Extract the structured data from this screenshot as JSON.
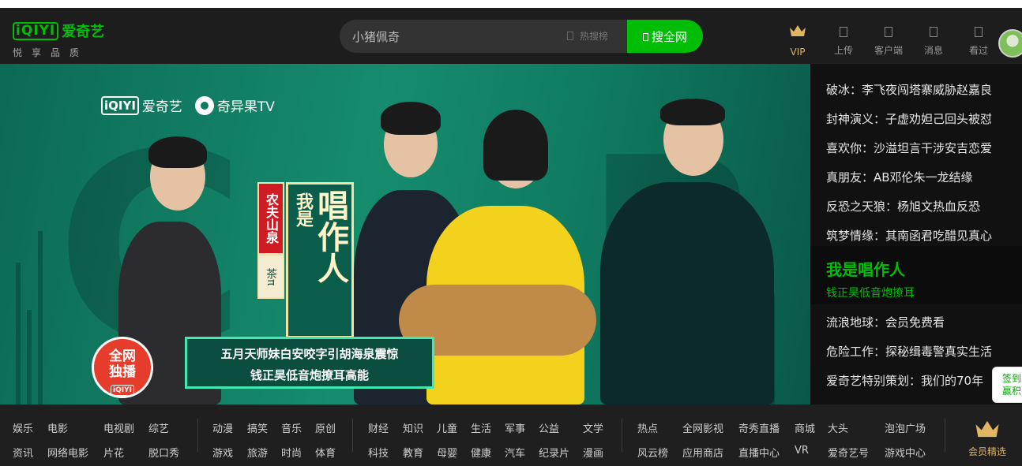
{
  "header": {
    "logo_mark": "iQIYI",
    "logo_name": "爱奇艺",
    "slogan": "悦享品质",
    "search_value": "小猪佩奇",
    "hot_label": "热搜榜",
    "search_button": "搜全网",
    "nav": [
      {
        "label": "VIP",
        "icon": "crown-icon"
      },
      {
        "label": "上传",
        "icon": "upload-icon"
      },
      {
        "label": "客户端",
        "icon": "client-icon"
      },
      {
        "label": "消息",
        "icon": "message-icon"
      },
      {
        "label": "看过",
        "icon": "history-icon"
      }
    ]
  },
  "banner": {
    "brand1_mark": "iQIYI",
    "brand1_name": "爱奇艺",
    "brand2_name": "奇异果TV",
    "sponsor_line1": "农夫山泉",
    "sponsor_line2": "茶π",
    "show_small": "我是",
    "show_big": "唱作人",
    "caption_line1": "五月天师妹白安咬字引胡海泉震惊",
    "caption_line2": "钱正昊低音炮撩耳高能",
    "exclusive_line1": "全网",
    "exclusive_line2": "独播",
    "exclusive_mark": "iQIYI"
  },
  "side_list": {
    "items_top": [
      "破冰：李飞夜闯塔寨威胁赵嘉良",
      "封神演义：子虚劝妲己回头被怼",
      "喜欢你：沙溢坦言干涉安吉恋爱",
      "真朋友：AB邓伦朱一龙结缘",
      "反恐之天狼：杨旭文热血反恐",
      "筑梦情缘：其南函君吃醋见真心"
    ],
    "active_title": "我是唱作人",
    "active_sub": "钱正昊低音炮撩耳",
    "items_bottom": [
      "流浪地球：会员免费看",
      "危险工作：探秘缉毒警真实生活",
      "爱奇艺特别策划：我们的70年"
    ]
  },
  "float": {
    "sign_line1": "签到",
    "sign_line2": "赢积"
  },
  "categories": {
    "groups": [
      {
        "row1": [
          "娱乐",
          "电影",
          "电视剧",
          "综艺"
        ],
        "row2": [
          "资讯",
          "网络电影",
          "片花",
          "脱口秀"
        ]
      },
      {
        "row1": [
          "动漫",
          "搞笑",
          "音乐",
          "原创"
        ],
        "row2": [
          "游戏",
          "旅游",
          "时尚",
          "体育"
        ]
      },
      {
        "row1": [
          "财经",
          "知识",
          "儿童",
          "生活",
          "军事",
          "公益",
          "文学"
        ],
        "row2": [
          "科技",
          "教育",
          "母婴",
          "健康",
          "汽车",
          "纪录片",
          "漫画"
        ]
      },
      {
        "row1": [
          "热点",
          "全网影视",
          "奇秀直播",
          "商城",
          "大头",
          "泡泡广场"
        ],
        "row2": [
          "风云榜",
          "应用商店",
          "直播中心",
          "VR",
          "爱奇艺号",
          "游戏中心"
        ]
      }
    ],
    "member_label": "会员精选"
  }
}
